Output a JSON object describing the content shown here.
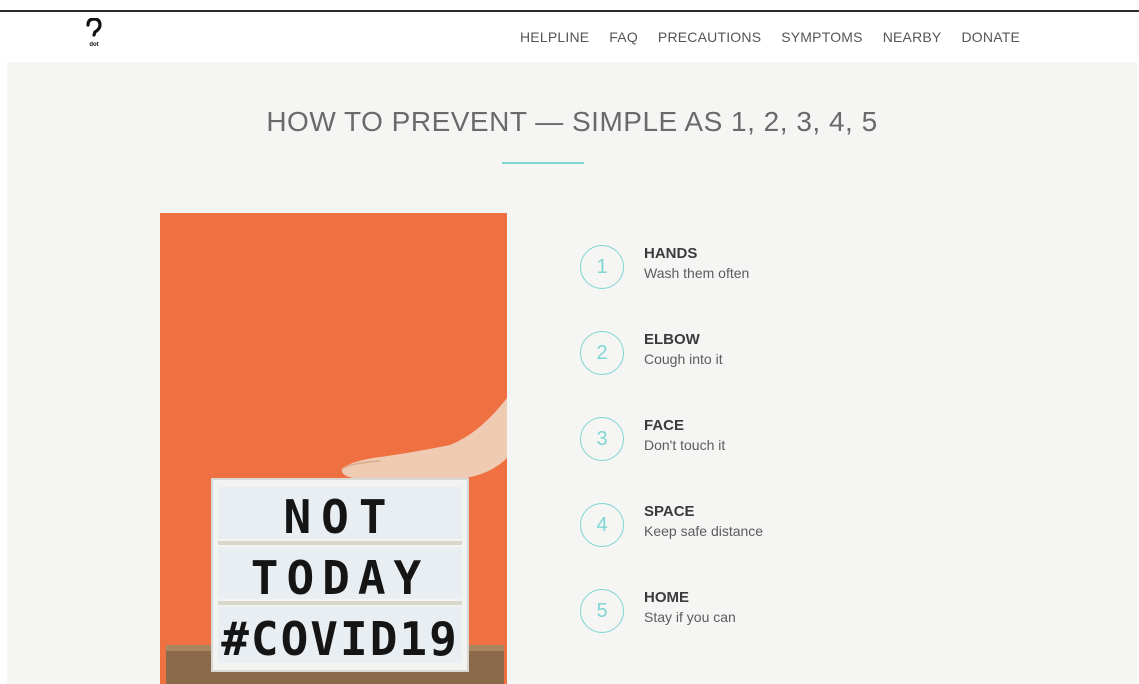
{
  "nav": {
    "logo_icon": "question-mark-logo-icon",
    "logo_caption": "dot",
    "links": [
      "HELPLINE",
      "FAQ",
      "PRECAUTIONS",
      "SYMPTOMS",
      "NEARBY",
      "DONATE"
    ]
  },
  "section": {
    "title": "HOW TO PREVENT — SIMPLE AS 1, 2, 3, 4, 5"
  },
  "photo": {
    "sign_lines": [
      "NOT",
      "TODAY",
      "#COVID19"
    ]
  },
  "steps": [
    {
      "number": "1",
      "title": "HANDS",
      "desc": "Wash them often"
    },
    {
      "number": "2",
      "title": "ELBOW",
      "desc": "Cough into it"
    },
    {
      "number": "3",
      "title": "FACE",
      "desc": "Don't touch it"
    },
    {
      "number": "4",
      "title": "SPACE",
      "desc": "Keep safe distance"
    },
    {
      "number": "5",
      "title": "HOME",
      "desc": "Stay if you can"
    }
  ],
  "colors": {
    "accent": "#7fd6d2",
    "photo_background": "#ef7040",
    "content_background": "#f5f5f4"
  }
}
